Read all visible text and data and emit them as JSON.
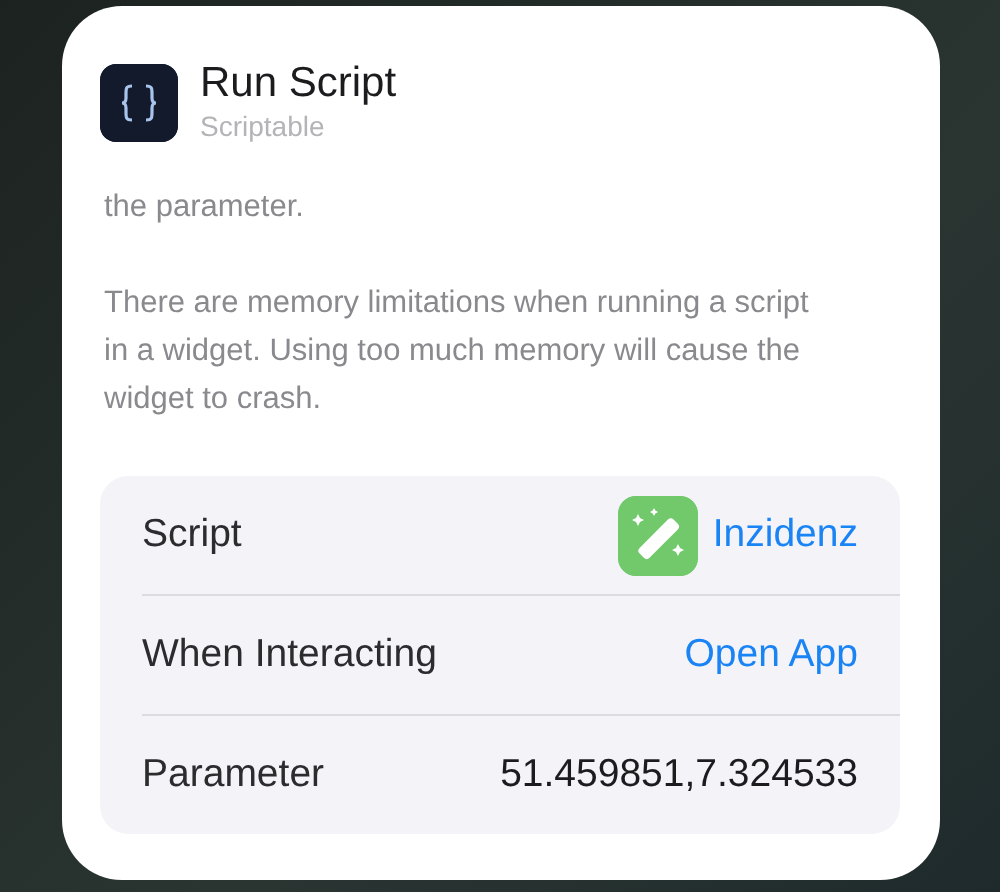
{
  "header": {
    "title": "Run Script",
    "subtitle": "Scriptable"
  },
  "description": [
    "the parameter.",
    "There are memory limitations when running a script in a widget. Using too much memory will cause the  widget to crash."
  ],
  "rows": [
    {
      "label": "Script",
      "value": "Inzidenz",
      "kind": "link",
      "has_icon": true
    },
    {
      "label": "When Interacting",
      "value": "Open App",
      "kind": "link",
      "has_icon": false
    },
    {
      "label": "Parameter",
      "value": "51.459851,7.324533",
      "kind": "plain",
      "has_icon": false
    }
  ]
}
